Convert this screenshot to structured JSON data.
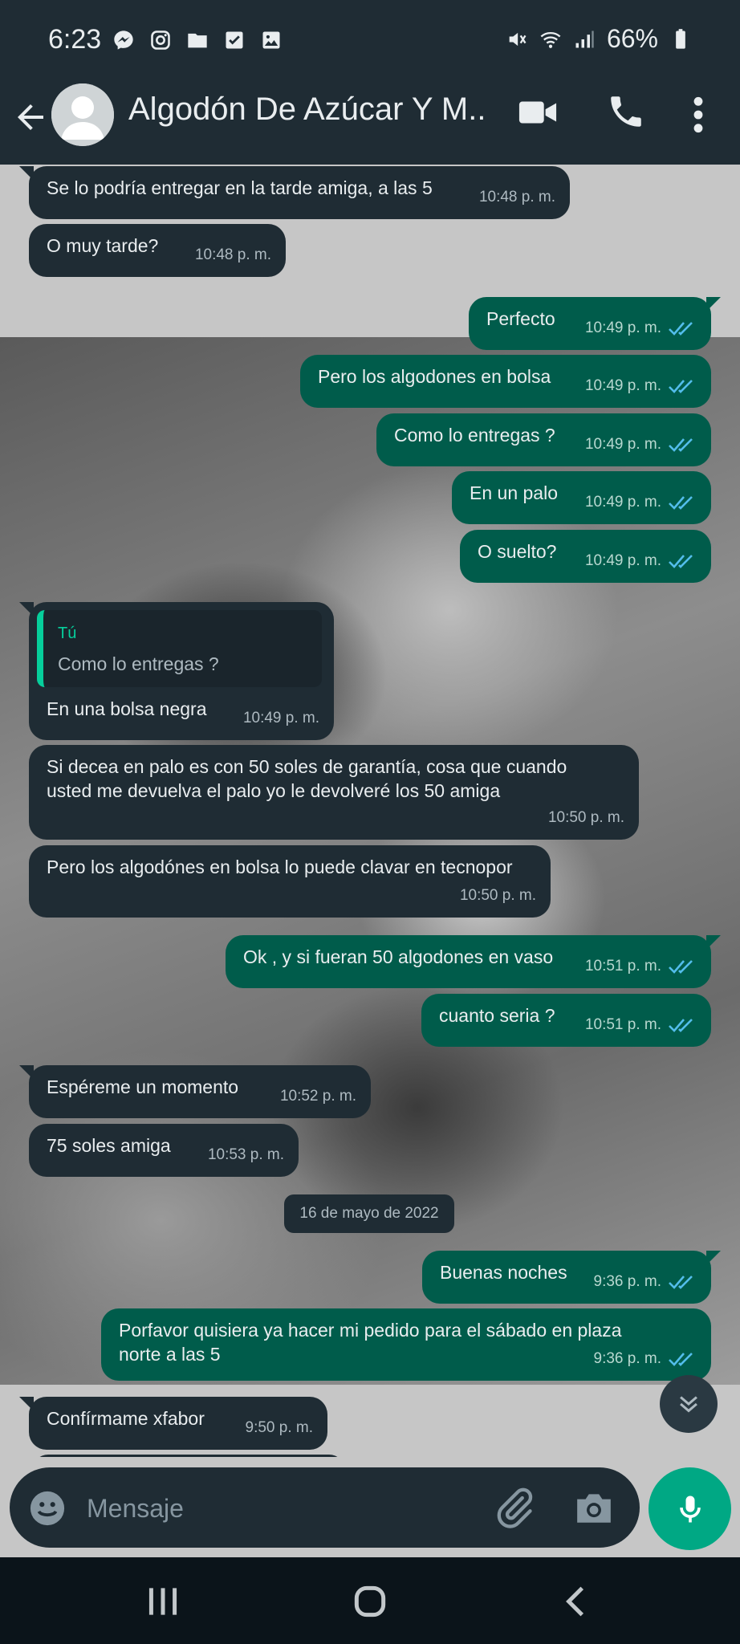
{
  "status_bar": {
    "time": "6:23",
    "battery": "66%",
    "left_icons": [
      "messenger-icon",
      "instagram-icon",
      "folder-icon",
      "checkbox-icon",
      "image-icon"
    ],
    "right_icons": [
      "mute-icon",
      "wifi-icon",
      "signal-icon",
      "battery-icon"
    ]
  },
  "header": {
    "contact_name": "Algodón De Azúcar Y M..."
  },
  "messages": [
    {
      "dir": "in",
      "text": "Se lo podría entregar en la tarde amiga, a las 5",
      "time": "10:48 p. m."
    },
    {
      "dir": "in",
      "text": "O muy tarde?",
      "time": "10:48 p. m."
    },
    {
      "dir": "out",
      "text": "Perfecto",
      "time": "10:49 p. m."
    },
    {
      "dir": "out",
      "text": "Pero los algodones en bolsa",
      "time": "10:49 p. m."
    },
    {
      "dir": "out",
      "text": "Como lo entregas ?",
      "time": "10:49 p. m."
    },
    {
      "dir": "out",
      "text": "En un palo",
      "time": "10:49 p. m."
    },
    {
      "dir": "out",
      "text": "O suelto?",
      "time": "10:49 p. m."
    },
    {
      "dir": "in",
      "quote_author": "Tú",
      "quote_text": "Como lo entregas ?",
      "text": "En una bolsa negra",
      "time": "10:49 p. m."
    },
    {
      "dir": "in",
      "text": "Si decea en palo es con 50 soles de garantía, cosa que cuando\nusted me devuelva el palo yo le devolveré los 50 amiga",
      "time": "10:50 p. m."
    },
    {
      "dir": "in",
      "text": "Pero los algodónes en bolsa lo puede clavar en tecnopor",
      "time": "10:50 p. m."
    },
    {
      "dir": "out",
      "text": "Ok , y si fueran 50 algodones en vaso",
      "time": "10:51 p. m."
    },
    {
      "dir": "out",
      "text": "cuanto seria ?",
      "time": "10:51 p. m."
    },
    {
      "dir": "in",
      "text": "Espéreme un momento",
      "time": "10:52 p. m."
    },
    {
      "dir": "in",
      "text": "75 soles amiga",
      "time": "10:53 p. m."
    },
    {
      "dir": "out",
      "text": "Buenas noches",
      "time": "9:36 p. m."
    },
    {
      "dir": "out",
      "text": "Porfavor quisiera ya hacer mi pedido para el sábado en plaza\nnorte a las 5",
      "time": "9:36 p. m."
    },
    {
      "dir": "in",
      "text": "Confírmame xfabor",
      "time": "9:50 p. m."
    }
  ],
  "date_divider": "16 de mayo de 2022",
  "composer": {
    "placeholder": "Mensaje"
  },
  "colors": {
    "header_bg": "#1f2c34",
    "incoming_bubble": "#1f2c34",
    "outgoing_bubble": "#005c4b",
    "accent": "#00a884",
    "read_ticks": "#53bdeb"
  }
}
